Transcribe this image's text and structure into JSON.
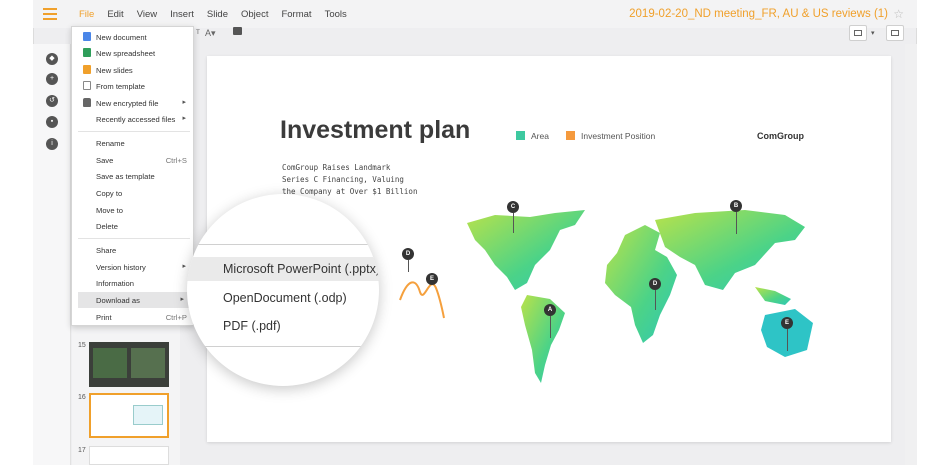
{
  "menubar": {
    "items": [
      "File",
      "Edit",
      "View",
      "Insert",
      "Slide",
      "Object",
      "Format",
      "Tools"
    ],
    "active_index": 0,
    "document_title": "2019-02-20_ND meeting_FR, AU & US reviews (1)",
    "accent_color": "#f0a02b"
  },
  "file_menu": {
    "items": [
      {
        "label": "New document",
        "icon": "document-icon",
        "icon_color": "#4a86e8"
      },
      {
        "label": "New spreadsheet",
        "icon": "spreadsheet-icon",
        "icon_color": "#2e9e5a"
      },
      {
        "label": "New slides",
        "icon": "slides-icon",
        "icon_color": "#f0a02b"
      },
      {
        "label": "From template",
        "icon": "template-icon",
        "icon_color": "#888888"
      },
      {
        "label": "New encrypted file",
        "icon": "lock-icon",
        "icon_color": "#666666",
        "submenu": true
      },
      {
        "label": "Recently accessed files",
        "submenu": true
      },
      {
        "label": "Rename"
      },
      {
        "label": "Save",
        "shortcut": "Ctrl+S"
      },
      {
        "label": "Save as template"
      },
      {
        "label": "Copy to"
      },
      {
        "label": "Move to"
      },
      {
        "label": "Delete"
      },
      {
        "label": "Share"
      },
      {
        "label": "Version history",
        "submenu": true
      },
      {
        "label": "Information"
      },
      {
        "label": "Download as",
        "submenu": true,
        "highlighted": true
      },
      {
        "label": "Print",
        "shortcut": "Ctrl+P"
      }
    ]
  },
  "download_submenu": {
    "items": [
      "Microsoft PowerPoint (.pptx)",
      "OpenDocument (.odp)",
      "PDF (.pdf)"
    ],
    "highlighted_index": 0
  },
  "thumbnails": {
    "numbers": [
      "15",
      "16",
      "17"
    ],
    "selected_index": 1
  },
  "slide": {
    "title": "Investment plan",
    "legend": [
      {
        "label": "Area",
        "color": "#3dc9a0"
      },
      {
        "label": "Investment Position",
        "color": "#f59a3d"
      }
    ],
    "brand": "ComGroup",
    "subtitle": "ComGroup Raises Landmark\nSeries C Financing, Valuing\nthe Company at Over $1 Billion",
    "pins": [
      "A",
      "B",
      "C",
      "D",
      "D",
      "E",
      "E"
    ]
  }
}
